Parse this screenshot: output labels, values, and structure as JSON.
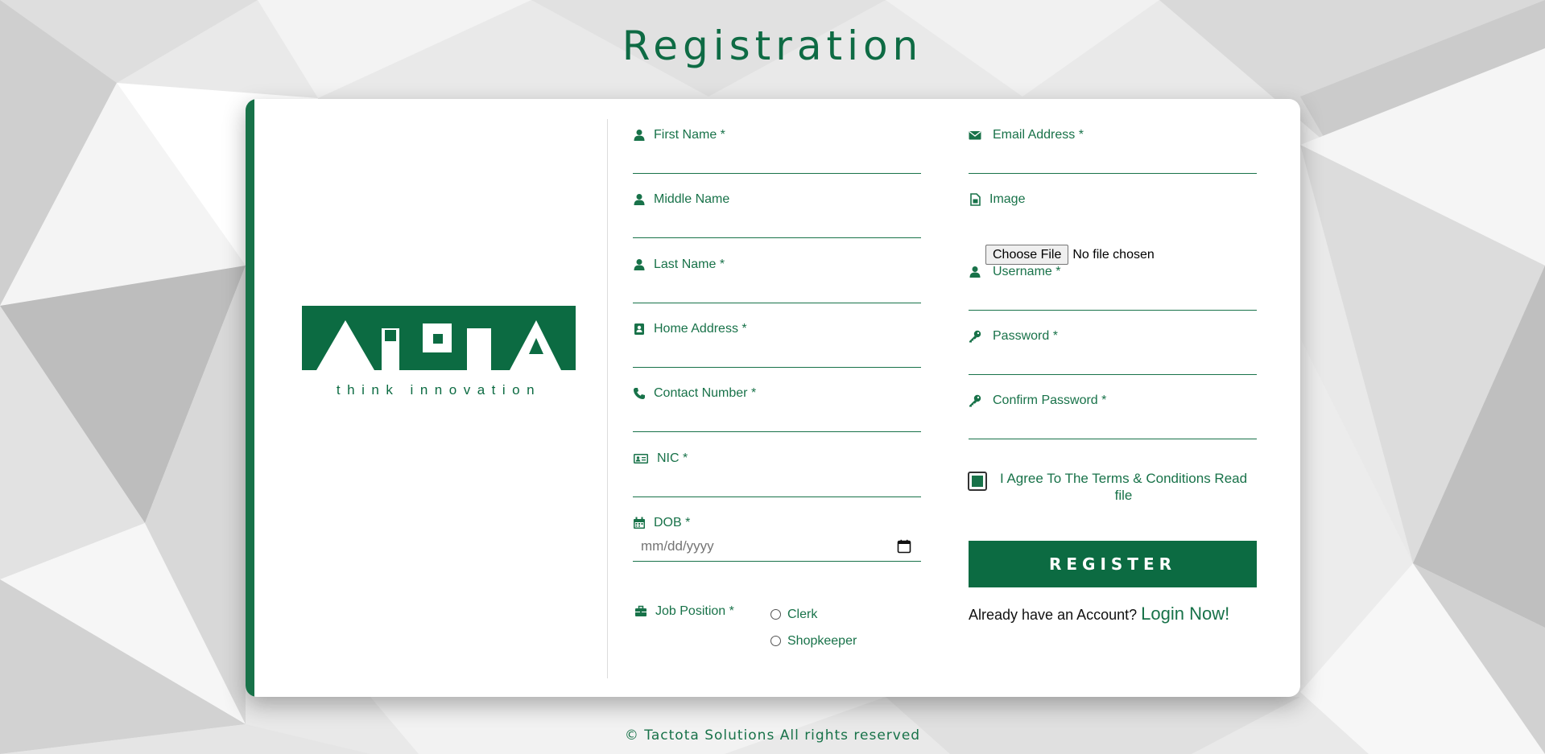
{
  "page": {
    "title": "Registration",
    "footer": "© Tactota Solutions All rights reserved"
  },
  "brand": {
    "logo_text": "TACTOTA",
    "tagline": "think innovation",
    "accent_color": "#187249",
    "button_color": "#0c6b42"
  },
  "form": {
    "left_column": [
      {
        "id": "first_name",
        "label": "First Name *",
        "icon": "user-icon",
        "value": ""
      },
      {
        "id": "middle_name",
        "label": "Middle Name",
        "icon": "user-icon",
        "value": ""
      },
      {
        "id": "last_name",
        "label": "Last Name *",
        "icon": "user-icon",
        "value": ""
      },
      {
        "id": "home_address",
        "label": "Home Address *",
        "icon": "address-book-icon",
        "value": ""
      },
      {
        "id": "contact_number",
        "label": "Contact Number *",
        "icon": "phone-icon",
        "value": ""
      },
      {
        "id": "nic",
        "label": "NIC *",
        "icon": "id-card-icon",
        "value": ""
      },
      {
        "id": "dob",
        "label": "DOB *",
        "icon": "calendar-icon",
        "placeholder": "mm/dd/yyyy"
      }
    ],
    "job_position": {
      "label": "Job Position *",
      "icon": "briefcase-icon",
      "options": [
        "Clerk",
        "Shopkeeper"
      ]
    },
    "right_column": {
      "email": {
        "label": "Email Address *",
        "icon": "envelope-icon",
        "value": ""
      },
      "image": {
        "label": "Image",
        "icon": "file-image-icon",
        "button_label": "Choose File",
        "status": "No file chosen"
      },
      "username": {
        "label": "Username *",
        "icon": "user-icon",
        "value": ""
      },
      "password": {
        "label": "Password *",
        "icon": "key-icon",
        "value": ""
      },
      "confirm_password": {
        "label": "Confirm Password *",
        "icon": "key-icon",
        "value": ""
      }
    },
    "terms": {
      "label": "I Agree To The Terms & Conditions Read file",
      "checked": true
    },
    "register_button": "REGISTER",
    "login": {
      "prompt": "Already have an Account?",
      "link": "Login Now!"
    }
  }
}
